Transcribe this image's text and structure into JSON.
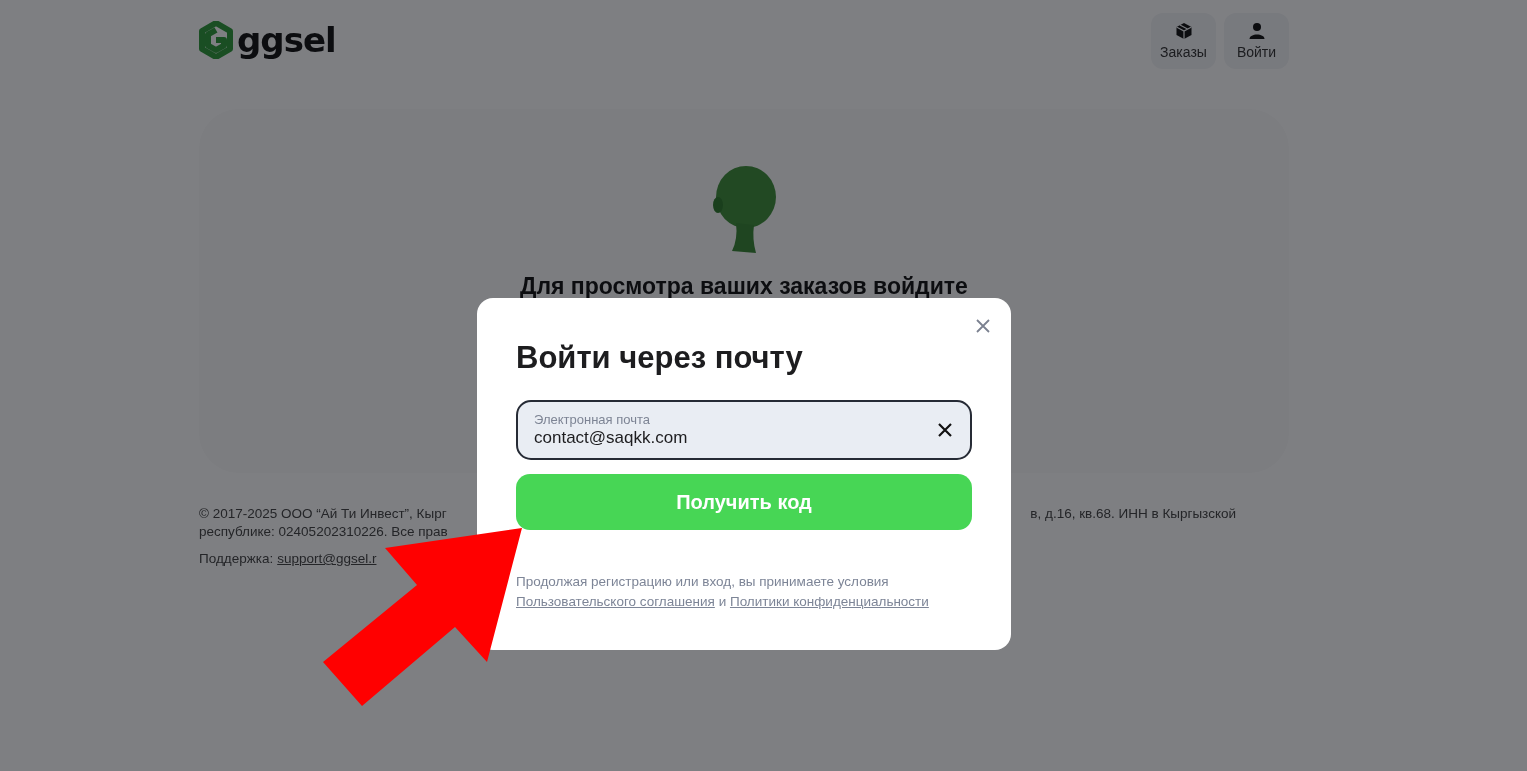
{
  "header": {
    "logo": "ggsel",
    "nav": [
      {
        "label": "Заказы"
      },
      {
        "label": "Войти"
      }
    ]
  },
  "orders_card": {
    "heading": "Для просмотра ваших заказов войдите"
  },
  "footer": {
    "copyright_left": [
      "© 2017-2025 ООО “Ай Ти Инвест”, Кырг",
      "республике: 02405202310226. Все прав"
    ],
    "copyright_right": "в, д.16, кв.68. ИНН в Кыргызской",
    "support_label": "Поддержка:",
    "support_link": "support@ggsel.r"
  },
  "modal": {
    "title": "Войти через почту",
    "email_field": {
      "label": "Электронная почта",
      "value": "contact@saqkk.com"
    },
    "submit": "Получить код",
    "terms": {
      "text": "Продолжая регистрацию или вход, вы принимаете условия",
      "link_1": "Пользовательского соглашения",
      "conjunction": "и",
      "link_2": "Политики конфиденциальности"
    }
  }
}
